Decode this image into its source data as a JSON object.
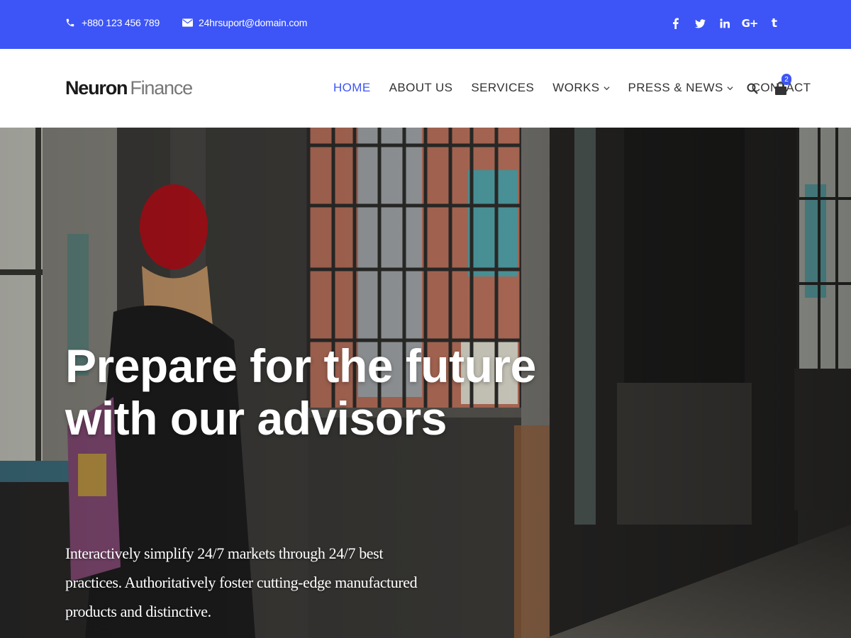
{
  "topbar": {
    "phone": "+880 123 456 789",
    "email": "24hrsuport@domain.com",
    "phone_icon": "phone-icon",
    "email_icon": "envelope-icon",
    "socials": [
      {
        "name": "facebook-icon",
        "glyph": "f"
      },
      {
        "name": "twitter-icon",
        "glyph": "twitter"
      },
      {
        "name": "linkedin-icon",
        "glyph": "in"
      },
      {
        "name": "google-plus-icon",
        "glyph": "G+"
      },
      {
        "name": "tumblr-icon",
        "glyph": "t"
      }
    ],
    "bg_color": "#3d55f6"
  },
  "header": {
    "logo_bold": "Neuron",
    "logo_light": "Finance",
    "nav": {
      "home": "HOME",
      "about": "ABOUT US",
      "services": "SERVICES",
      "works": "WORKS",
      "press": "PRESS & NEWS",
      "contact": "CONTACT"
    },
    "active_color": "#3d55f6",
    "search_icon": "search-icon",
    "cart_icon": "shopping-bag-icon",
    "cart_count": "2"
  },
  "hero": {
    "title_line1": "Prepare for the future",
    "title_line2": "with our advisors",
    "text": "Interactively simplify 24/7 markets through 24/7 best practices. Authoritatively foster cutting-edge manufactured products and distinctive."
  }
}
